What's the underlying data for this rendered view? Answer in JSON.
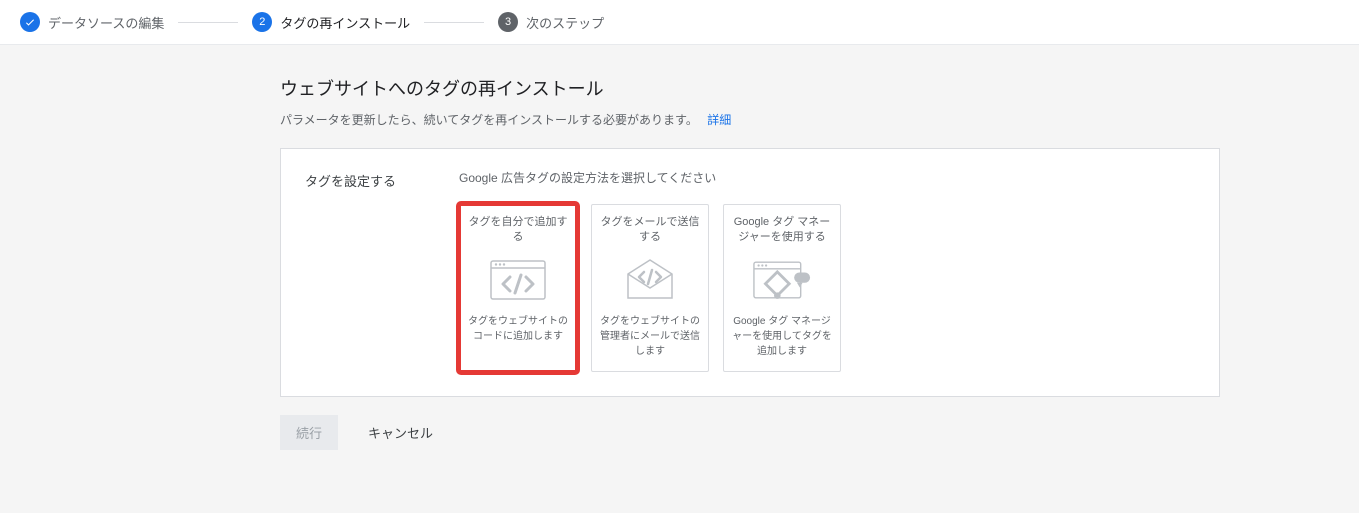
{
  "stepper": {
    "steps": [
      {
        "label": "データソースの編集",
        "state": "done"
      },
      {
        "label": "タグの再インストール",
        "state": "active",
        "num": "2"
      },
      {
        "label": "次のステップ",
        "state": "pending",
        "num": "3"
      }
    ]
  },
  "page": {
    "title": "ウェブサイトへのタグの再インストール",
    "subtitle": "パラメータを更新したら、続いてタグを再インストールする必要があります。",
    "learn_more": "詳細"
  },
  "setup": {
    "section_label": "タグを設定する",
    "hint": "Google 広告タグの設定方法を選択してください",
    "options": [
      {
        "title": "タグを自分で追加する",
        "desc": "タグをウェブサイトのコードに追加します",
        "highlighted": true,
        "icon": "code"
      },
      {
        "title": "タグをメールで送信する",
        "desc": "タグをウェブサイトの管理者にメールで送信します",
        "highlighted": false,
        "icon": "mail"
      },
      {
        "title": "Google タグ マネージャーを使用する",
        "desc": "Google タグ マネージャーを使用してタグを追加します",
        "highlighted": false,
        "icon": "gtm"
      }
    ]
  },
  "actions": {
    "continue": "続行",
    "cancel": "キャンセル"
  }
}
